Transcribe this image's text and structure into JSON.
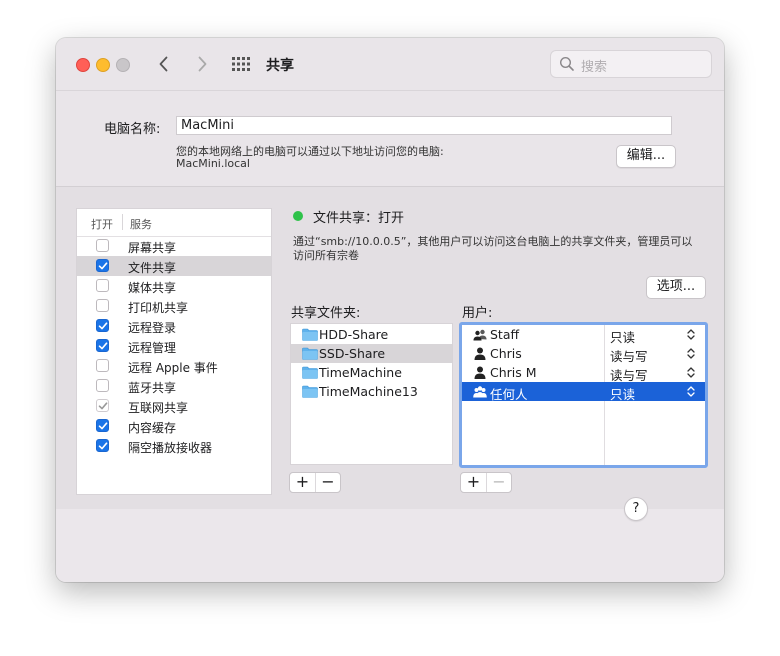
{
  "window": {
    "title": "共享",
    "search_placeholder": "搜索"
  },
  "computer": {
    "name_label": "电脑名称:",
    "name_value": "MacMini",
    "address_line1": "您的本地网络上的电脑可以通过以下地址访问您的电脑:",
    "address_line2": "MacMini.local",
    "edit_label": "编辑..."
  },
  "services": {
    "header_on": "打开",
    "header_service": "服务",
    "items": [
      {
        "label": "屏幕共享",
        "checked": false,
        "selected": false
      },
      {
        "label": "文件共享",
        "checked": true,
        "selected": true
      },
      {
        "label": "媒体共享",
        "checked": false,
        "selected": false
      },
      {
        "label": "打印机共享",
        "checked": false,
        "selected": false
      },
      {
        "label": "远程登录",
        "checked": true,
        "selected": false
      },
      {
        "label": "远程管理",
        "checked": true,
        "selected": false
      },
      {
        "label": "远程 Apple 事件",
        "checked": false,
        "selected": false
      },
      {
        "label": "蓝牙共享",
        "checked": false,
        "selected": false
      },
      {
        "label": "互联网共享",
        "checked": true,
        "dimmed": true,
        "selected": false
      },
      {
        "label": "内容缓存",
        "checked": true,
        "selected": false
      },
      {
        "label": "隔空播放接收器",
        "checked": true,
        "selected": false
      }
    ]
  },
  "file_sharing": {
    "status": "文件共享：打开",
    "status_color": "#2fc24a",
    "desc_line1": "通过“smb://10.0.0.5”，其他用户可以访问这台电脑上的共享文件夹，管理员可以",
    "desc_line2": "访问所有宗卷",
    "options_label": "选项...",
    "folders_label": "共享文件夹:",
    "users_label": "用户:",
    "folders": [
      {
        "name": "HDD-Share",
        "selected": false
      },
      {
        "name": "SSD-Share",
        "selected": true
      },
      {
        "name": "TimeMachine",
        "selected": false
      },
      {
        "name": "TimeMachine13",
        "selected": false
      }
    ],
    "users": [
      {
        "name": "Staff",
        "permission": "只读",
        "icon": "group-icon",
        "selected": false
      },
      {
        "name": "Chris",
        "permission": "读与写",
        "icon": "user-icon",
        "selected": false
      },
      {
        "name": "Chris M",
        "permission": "读与写",
        "icon": "user-icon",
        "selected": false
      },
      {
        "name": "任何人",
        "permission": "只读",
        "icon": "everyone-icon",
        "selected": true
      }
    ],
    "plus_label": "+",
    "minus_label": "−"
  },
  "help_label": "?"
}
